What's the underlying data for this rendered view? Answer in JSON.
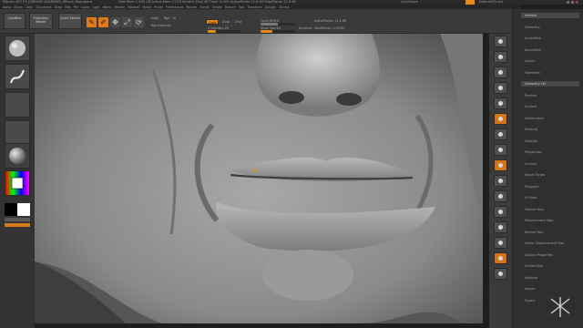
{
  "title_bar": {
    "left": "ZBrush 4R7 P3 [ZBRUSH ACADEMY] ZBrush Document",
    "mid": "Free Mem 1.392 GB  Active Mem 1.073  Scratch Disk 48  Timer 0.005  ActivePoints 11.8 Mil  TotalPoints 11.8 Mil",
    "right": "QuickSave",
    "menus_label": "Menus",
    "default_label": "DefaultZScript"
  },
  "menubar": [
    "Alpha",
    "Brush",
    "Color",
    "Document",
    "Draw",
    "Edit",
    "File",
    "Layer",
    "Light",
    "Macro",
    "Marker",
    "Material",
    "Movie",
    "Picker",
    "Preferences",
    "Render",
    "Stencil",
    "Stroke",
    "Texture",
    "Tool",
    "Transform",
    "Zplugin",
    "Zscript"
  ],
  "shelf": {
    "lightbox": "LightBox",
    "projection": "Projection Master",
    "quick_sketch": "Quick Sketch",
    "edit": "Edit",
    "draw": "Draw",
    "move": "Move",
    "scale": "Scale",
    "rotate": "Rotate",
    "mrgb": "Mrgb",
    "rgb": "Rgb",
    "m": "M",
    "zadd": "Zadd",
    "zsub": "Zsub",
    "zcut": "Zcut",
    "rgb_intensity": "Rgb Intensity",
    "z_intensity": "Z Intensity 25",
    "focal_shift": "Focal Shift 0",
    "draw_size": "Draw Size 64",
    "dynamic": "Dynamic",
    "active_points": "ActivePoints: 11.8 Mil",
    "total_points": "TotalPoints: 11.8 Mil"
  },
  "shelf_levels": {
    "z_intensity": 0.25,
    "draw_size": 0.35,
    "focal_shift": 0.5
  },
  "right_tray": {
    "items": [
      "Subtool",
      "Geometry",
      "ArrayMesh",
      "NanoMesh",
      "Layers",
      "FiberMesh",
      "Geometry HD",
      "Preview",
      "Surface",
      "Deformation",
      "Masking",
      "Visibility",
      "Polygroups",
      "Contact",
      "Morph Target",
      "Polypaint",
      "UV Map",
      "Texture Map",
      "Displacement Map",
      "Normal Map",
      "Vector Displacement Map",
      "Display Properties",
      "Unified Skin",
      "Initialize",
      "Import",
      "Export"
    ]
  },
  "colors": {
    "accent": "#e88a1a",
    "ui_dark": "#2f2f2f",
    "sculpt_clay": "#8a8a8a"
  },
  "icons": {
    "left_shelf": [
      "sphere-brush-icon",
      "stroke-icon",
      "alpha-icon",
      "texture-icon",
      "material-icon"
    ],
    "right_shelf": [
      "bpr-icon",
      "scroll-icon",
      "zoom-icon",
      "actual-icon",
      "aahalf-icon",
      "persp-icon",
      "floor-icon",
      "local-icon",
      "lsym-icon",
      "frame-icon",
      "move-icon",
      "scale-icon",
      "rotate-icon",
      "polyf-icon",
      "transp-icon",
      "solo-icon"
    ]
  }
}
